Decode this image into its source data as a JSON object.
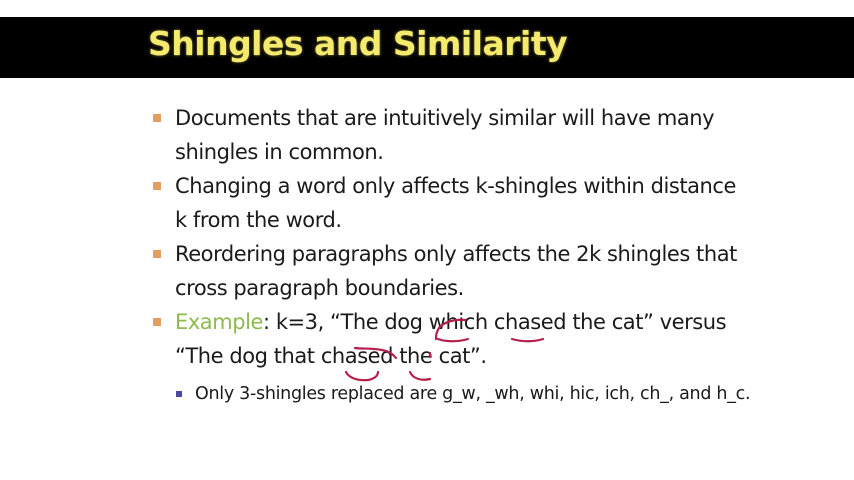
{
  "slide": {
    "title": "Shingles and Similarity",
    "bullets": [
      {
        "text": "Documents that are intuitively similar will have many shingles in common."
      },
      {
        "text": "Changing a word only affects k-shingles within distance k from the word."
      },
      {
        "text": "Reordering paragraphs only affects the 2k shingles that cross paragraph boundaries."
      }
    ],
    "example": {
      "label": "Example",
      "text": ": k=3, “The dog which chased the cat” versus “The dog that chased the cat”.",
      "sub_bullet": "Only 3-shingles replaced are g_w, _wh, whi, hic, ich, ch_, and h_c."
    }
  },
  "colors": {
    "title_bg": "#000000",
    "title_text": "#f4ea6e",
    "bullet_marker": "#e1a062",
    "example_label": "#8dba4f",
    "sub_marker": "#4a4aa0",
    "ink": "#b51f4a"
  }
}
